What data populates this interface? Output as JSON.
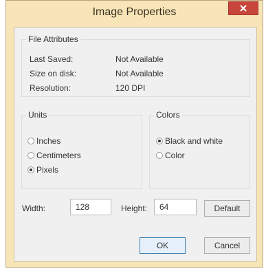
{
  "dialog": {
    "title": "Image Properties",
    "close_glyph": "✕"
  },
  "file_attributes": {
    "label": "File Attributes",
    "rows": [
      {
        "key": "Last Saved:",
        "value": "Not Available"
      },
      {
        "key": "Size on disk:",
        "value": "Not Available"
      },
      {
        "key": "Resolution:",
        "value": "120 DPI"
      }
    ]
  },
  "units": {
    "label": "Units",
    "options": [
      {
        "label": "Inches",
        "checked": false
      },
      {
        "label": "Centimeters",
        "checked": false
      },
      {
        "label": "Pixels",
        "checked": true
      }
    ]
  },
  "colors": {
    "label": "Colors",
    "options": [
      {
        "label": "Black and white",
        "checked": true
      },
      {
        "label": "Color",
        "checked": false
      }
    ]
  },
  "size": {
    "width_label": "Width:",
    "width_value": "128",
    "height_label": "Height:",
    "height_value": "64",
    "default_button": "Default"
  },
  "buttons": {
    "ok": "OK",
    "cancel": "Cancel"
  },
  "colors_theme": {
    "frame": "#f7e5b8",
    "close_button": "#c8453b",
    "client": "#f0f0f0"
  }
}
